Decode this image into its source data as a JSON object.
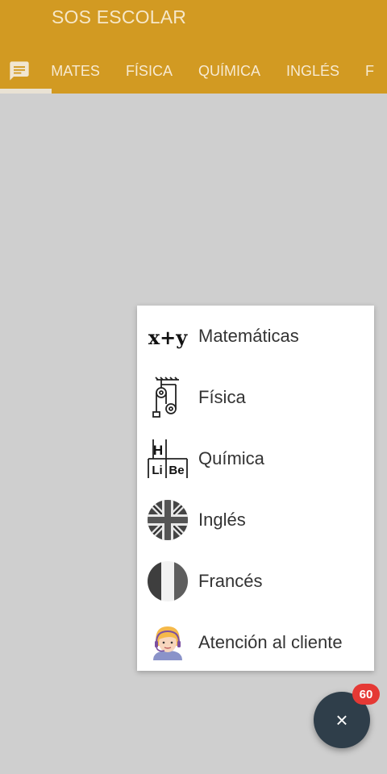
{
  "app": {
    "title": "SOS ESCOLAR"
  },
  "tabs": [
    {
      "label": "MATES"
    },
    {
      "label": "FÍSICA"
    },
    {
      "label": "QUÍMICA"
    },
    {
      "label": "INGLÉS"
    },
    {
      "label": "F"
    }
  ],
  "icons": {
    "chat_tab": "chat-icon",
    "close": "close-icon"
  },
  "menu": {
    "items": [
      {
        "label": "Matemáticas",
        "icon": "math-icon",
        "icon_text": "x+y"
      },
      {
        "label": "Física",
        "icon": "physics-pulley-icon"
      },
      {
        "label": "Química",
        "icon": "periodic-table-icon",
        "icon_text": [
          "H",
          "Li",
          "Be"
        ]
      },
      {
        "label": "Inglés",
        "icon": "uk-flag-icon"
      },
      {
        "label": "Francés",
        "icon": "france-flag-icon"
      },
      {
        "label": "Atención al cliente",
        "icon": "support-agent-icon"
      }
    ]
  },
  "fab": {
    "badge_count": "60"
  },
  "colors": {
    "app_bar": "#d29a22",
    "background": "#cfcfcf",
    "fab": "#2f3e4a",
    "badge": "#e53935"
  }
}
